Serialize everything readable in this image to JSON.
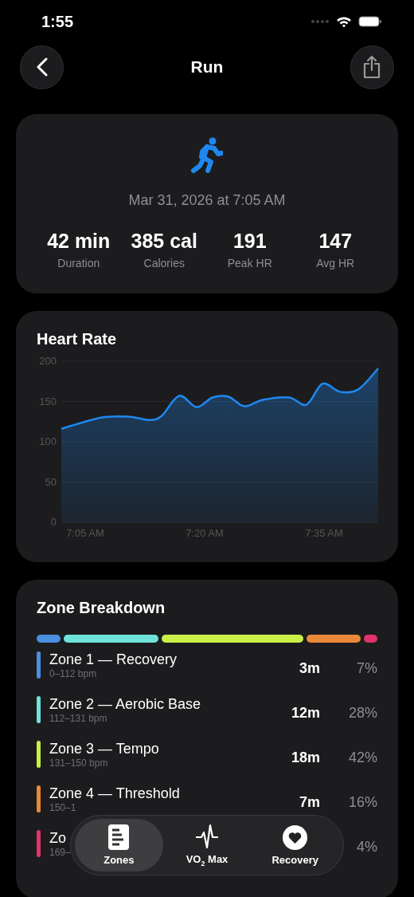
{
  "status_bar": {
    "time": "1:55"
  },
  "nav": {
    "title": "Run"
  },
  "summary": {
    "date": "Mar 31, 2026 at 7:05 AM",
    "stats": [
      {
        "value": "42 min",
        "label": "Duration"
      },
      {
        "value": "385 cal",
        "label": "Calories"
      },
      {
        "value": "191",
        "label": "Peak HR"
      },
      {
        "value": "147",
        "label": "Avg HR"
      }
    ]
  },
  "heart_rate": {
    "title": "Heart Rate",
    "chart_data": {
      "type": "area",
      "x": [
        422,
        427,
        430.6,
        433,
        434.6,
        436.8,
        439,
        441,
        443,
        445,
        447.3,
        450.6,
        452.8,
        454.8,
        457,
        459.3,
        461.8
      ],
      "grid": true,
      "series": [
        {
          "color": "#1e88f0",
          "values": [
            116,
            130,
            131,
            127,
            132,
            157,
            143,
            155,
            156,
            144,
            152,
            155,
            146,
            172,
            162,
            165,
            191
          ]
        }
      ],
      "xlim": [
        422,
        461.8
      ],
      "ylim": [
        0,
        200
      ],
      "yticks": [
        0,
        50,
        100,
        150,
        200
      ],
      "xticks": [
        {
          "value": 425,
          "label": "7:05 AM"
        },
        {
          "value": 440,
          "label": "7:20 AM"
        },
        {
          "value": 455,
          "label": "7:35 AM"
        }
      ]
    }
  },
  "zones": {
    "title": "Zone Breakdown",
    "items": [
      {
        "name": "Zone 1 — Recovery",
        "range": "0–112 bpm",
        "time": "3m",
        "percent": "7%",
        "color": "#4a8fe0"
      },
      {
        "name": "Zone 2 — Aerobic Base",
        "range": "112–131 bpm",
        "time": "12m",
        "percent": "28%",
        "color": "#6fe3da"
      },
      {
        "name": "Zone 3 — Tempo",
        "range": "131–150 bpm",
        "time": "18m",
        "percent": "42%",
        "color": "#c8f046"
      },
      {
        "name": "Zone 4 — Threshold",
        "range": "150–1",
        "time": "7m",
        "percent": "16%",
        "color": "#ea883a"
      },
      {
        "name": "Zo",
        "range": "169–",
        "percent": "4%",
        "color": "#e0336e"
      }
    ]
  },
  "tab_bar": {
    "tabs": [
      {
        "label": "Zones",
        "kind": "zones",
        "selected": true
      },
      {
        "label": "VO$_{2}$ Max",
        "kind": "vo2",
        "selected": false
      },
      {
        "label": "Recovery",
        "kind": "recovery",
        "selected": false
      }
    ]
  }
}
